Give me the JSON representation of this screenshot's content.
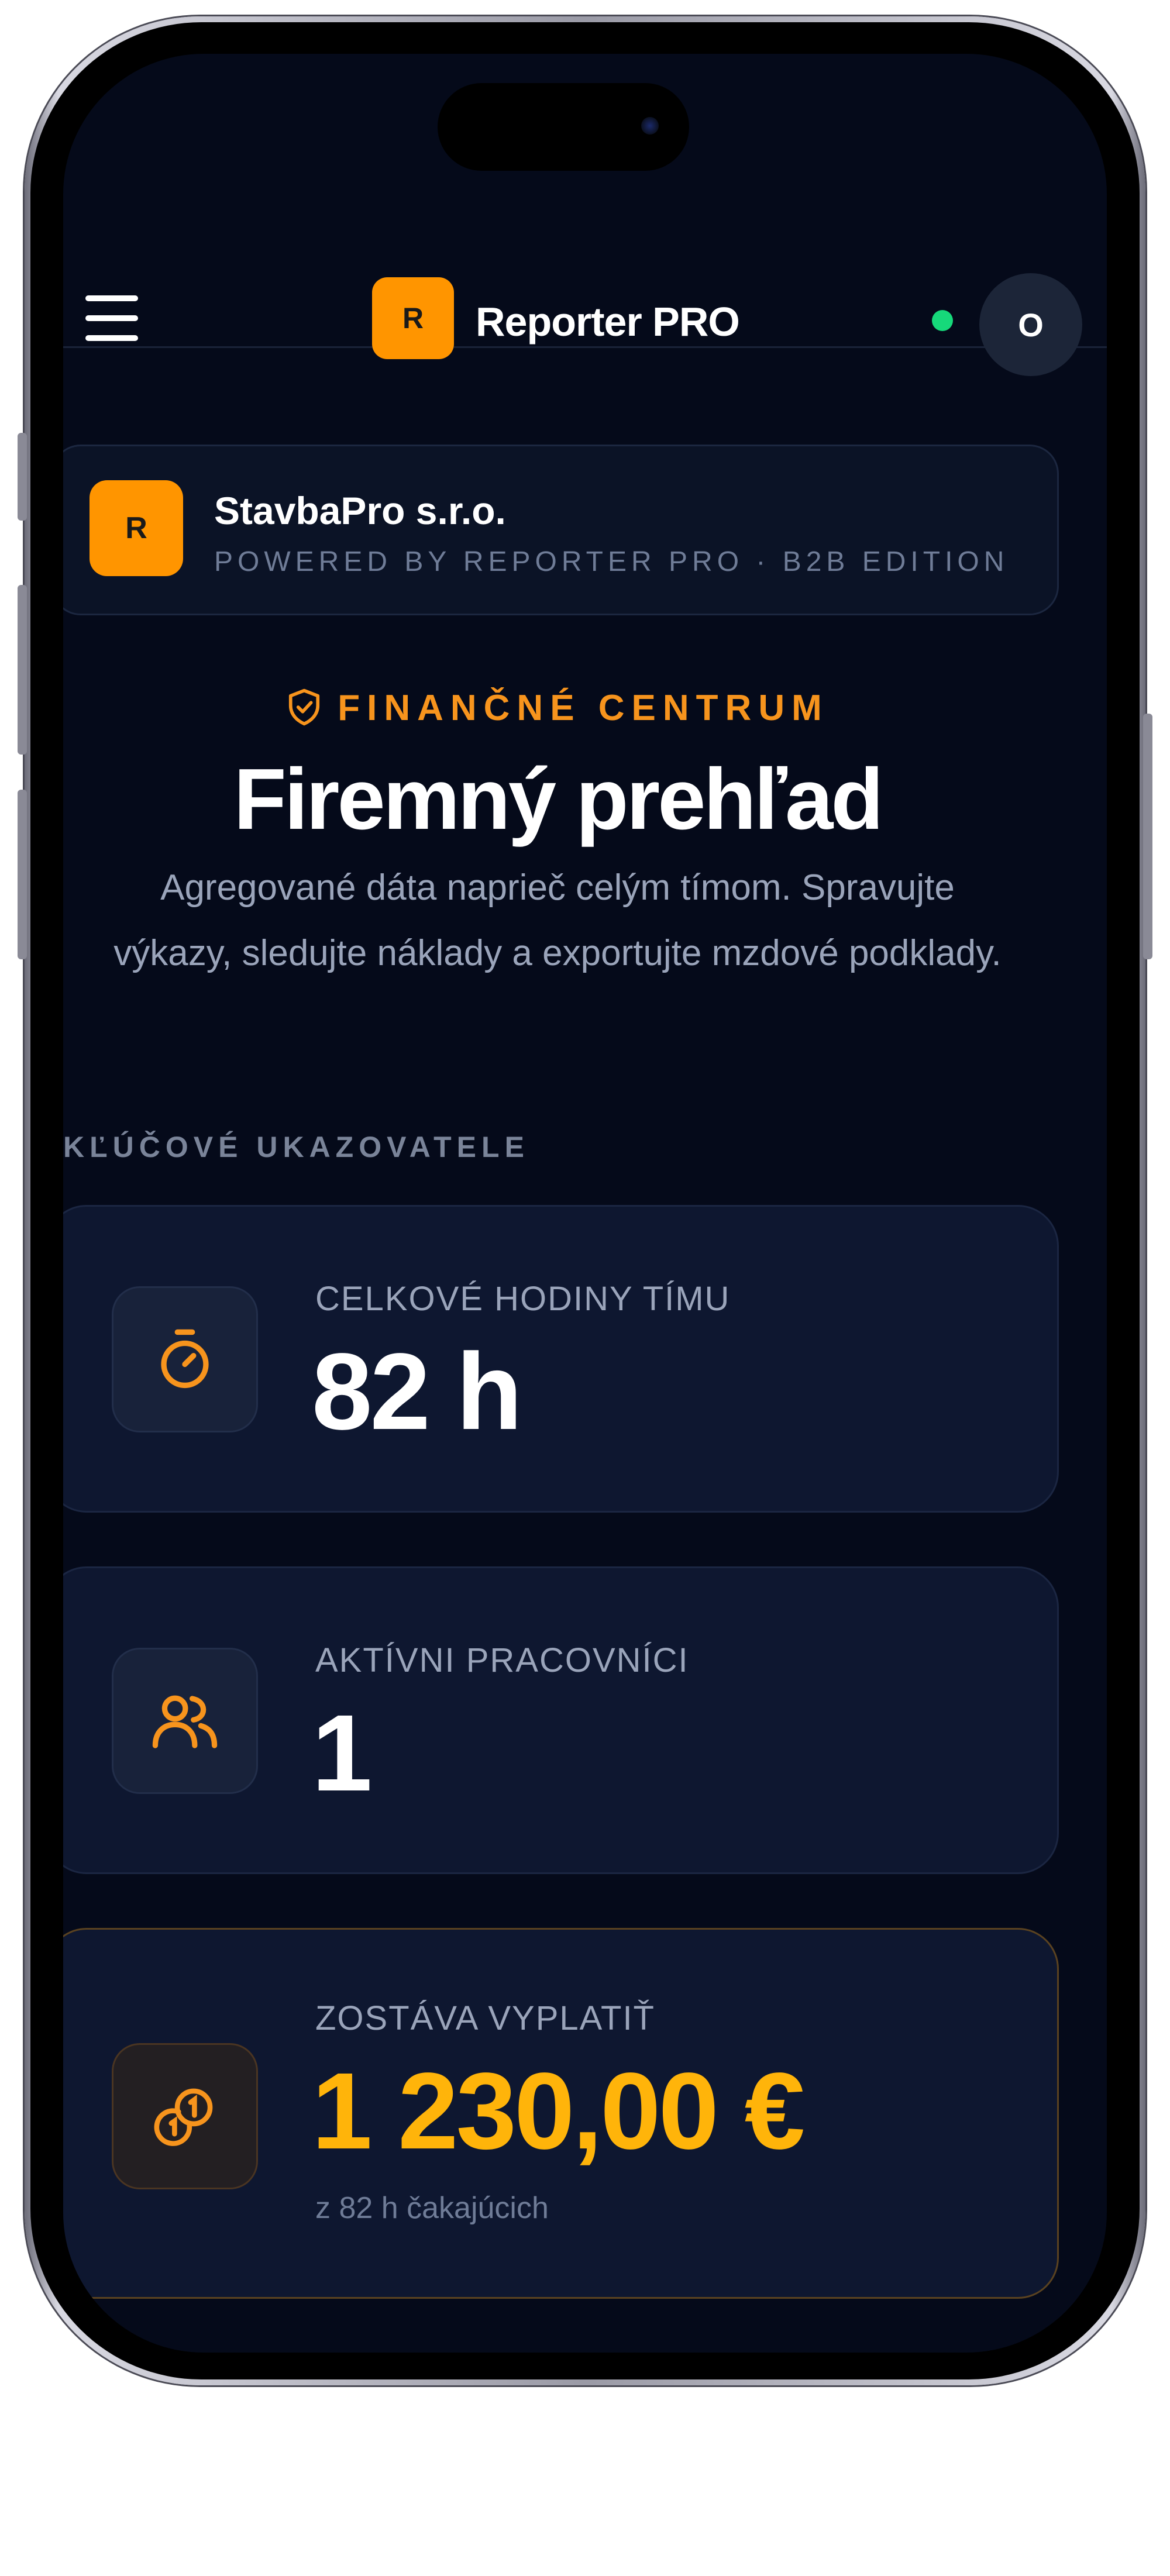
{
  "header": {
    "logo_letter": "R",
    "app_title": "Reporter PRO",
    "avatar_initial": "O",
    "status_color": "#16d97a"
  },
  "company": {
    "logo_letter": "R",
    "name": "StavbaPro s.r.o.",
    "subtitle": "POWERED BY REPORTER PRO · B2B EDITION"
  },
  "hero": {
    "eyebrow": "FINANČNÉ CENTRUM",
    "title": "Firemný prehľad",
    "description_line1": "Agregované dáta naprieč celým tímom. Spravujte",
    "description_line2": "výkazy, sledujte náklady a exportujte mzdové podklady."
  },
  "section_label": "KĽÚČOVÉ UKAZOVATELE",
  "kpis": [
    {
      "label": "CELKOVÉ HODINY TÍMU",
      "value": "82 h",
      "icon": "stopwatch-icon"
    },
    {
      "label": "AKTÍVNI PRACOVNÍCI",
      "value": "1",
      "icon": "users-icon"
    },
    {
      "label": "ZOSTÁVA VYPLATIŤ",
      "value": "1 230,00 €",
      "sub": "z 82 h čakajúcich",
      "icon": "coins-icon"
    }
  ],
  "colors": {
    "accent": "#ff9500",
    "background": "#050a1a",
    "payout": "#ffb40a"
  }
}
